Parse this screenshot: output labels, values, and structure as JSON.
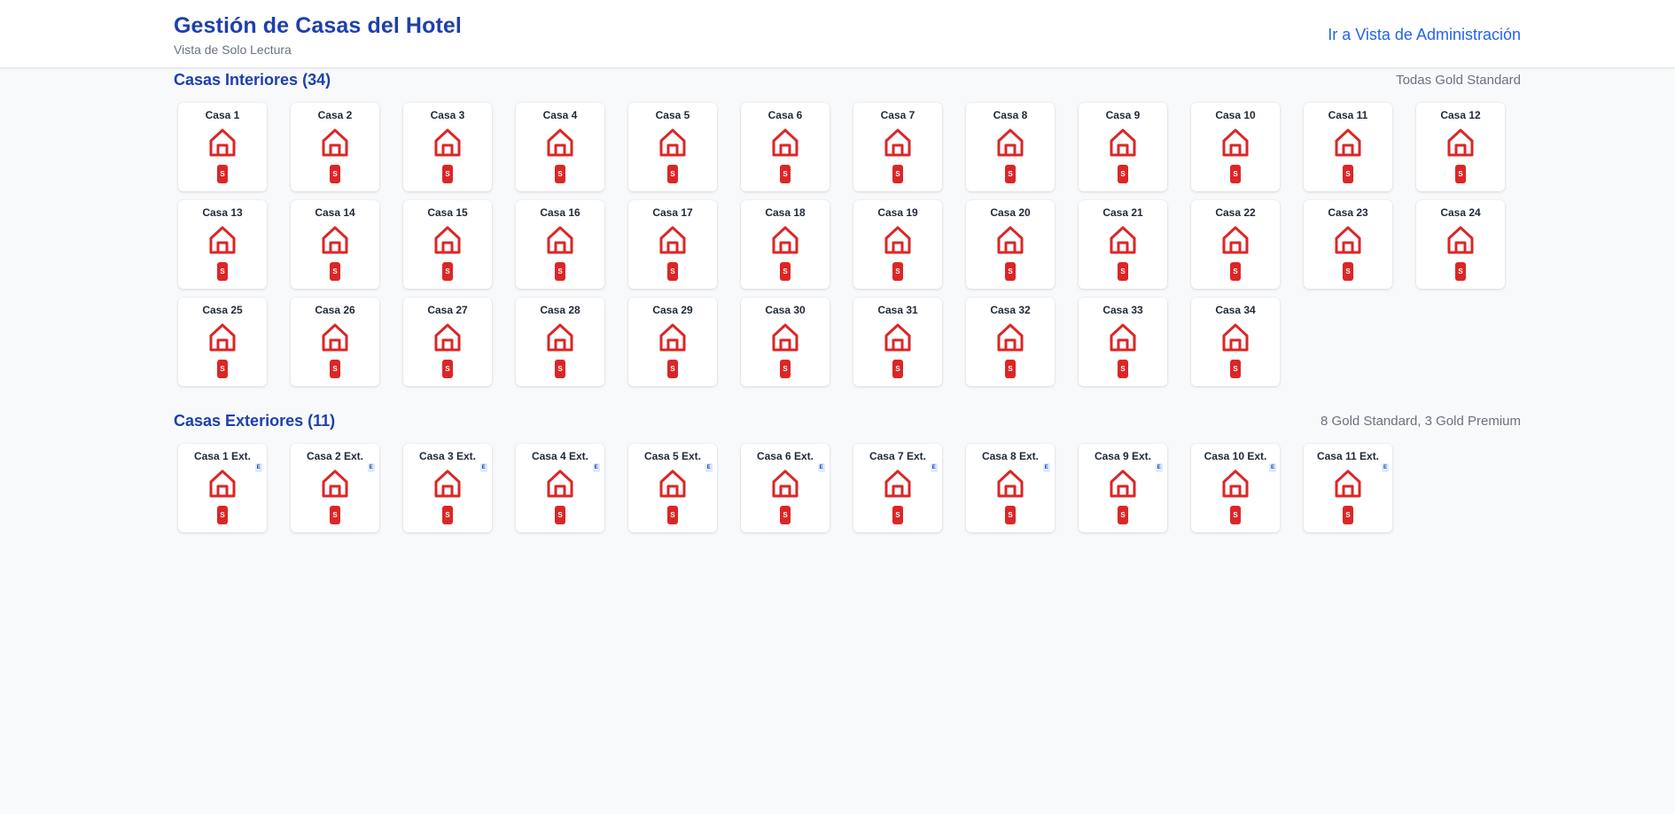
{
  "header": {
    "title": "Gestión de Casas del Hotel",
    "subtitle": "Vista de Solo Lectura",
    "admin_link": "Ir a Vista de Administración"
  },
  "interior": {
    "title": "Casas Interiores (34)",
    "summary": "Todas Gold Standard",
    "houses": [
      {
        "name": "Casa 1",
        "level": "S"
      },
      {
        "name": "Casa 2",
        "level": "S"
      },
      {
        "name": "Casa 3",
        "level": "S"
      },
      {
        "name": "Casa 4",
        "level": "S"
      },
      {
        "name": "Casa 5",
        "level": "S"
      },
      {
        "name": "Casa 6",
        "level": "S"
      },
      {
        "name": "Casa 7",
        "level": "S"
      },
      {
        "name": "Casa 8",
        "level": "S"
      },
      {
        "name": "Casa 9",
        "level": "S"
      },
      {
        "name": "Casa 10",
        "level": "S"
      },
      {
        "name": "Casa 11",
        "level": "S"
      },
      {
        "name": "Casa 12",
        "level": "S"
      },
      {
        "name": "Casa 13",
        "level": "S"
      },
      {
        "name": "Casa 14",
        "level": "S"
      },
      {
        "name": "Casa 15",
        "level": "S"
      },
      {
        "name": "Casa 16",
        "level": "S"
      },
      {
        "name": "Casa 17",
        "level": "S"
      },
      {
        "name": "Casa 18",
        "level": "S"
      },
      {
        "name": "Casa 19",
        "level": "S"
      },
      {
        "name": "Casa 20",
        "level": "S"
      },
      {
        "name": "Casa 21",
        "level": "S"
      },
      {
        "name": "Casa 22",
        "level": "S"
      },
      {
        "name": "Casa 23",
        "level": "S"
      },
      {
        "name": "Casa 24",
        "level": "S"
      },
      {
        "name": "Casa 25",
        "level": "S"
      },
      {
        "name": "Casa 26",
        "level": "S"
      },
      {
        "name": "Casa 27",
        "level": "S"
      },
      {
        "name": "Casa 28",
        "level": "S"
      },
      {
        "name": "Casa 29",
        "level": "S"
      },
      {
        "name": "Casa 30",
        "level": "S"
      },
      {
        "name": "Casa 31",
        "level": "S"
      },
      {
        "name": "Casa 32",
        "level": "S"
      },
      {
        "name": "Casa 33",
        "level": "S"
      },
      {
        "name": "Casa 34",
        "level": "S"
      }
    ]
  },
  "exterior": {
    "title": "Casas Exteriores (11)",
    "summary": "8 Gold Standard, 3 Gold Premium",
    "houses": [
      {
        "name": "Casa 1 Ext.",
        "level": "S",
        "tag": "E"
      },
      {
        "name": "Casa 2 Ext.",
        "level": "S",
        "tag": "E"
      },
      {
        "name": "Casa 3 Ext.",
        "level": "S",
        "tag": "E"
      },
      {
        "name": "Casa 4 Ext.",
        "level": "S",
        "tag": "E"
      },
      {
        "name": "Casa 5 Ext.",
        "level": "S",
        "tag": "E"
      },
      {
        "name": "Casa 6 Ext.",
        "level": "S",
        "tag": "E"
      },
      {
        "name": "Casa 7 Ext.",
        "level": "S",
        "tag": "E"
      },
      {
        "name": "Casa 8 Ext.",
        "level": "S",
        "tag": "E"
      },
      {
        "name": "Casa 9 Ext.",
        "level": "S",
        "tag": "E"
      },
      {
        "name": "Casa 10 Ext.",
        "level": "S",
        "tag": "E"
      },
      {
        "name": "Casa 11 Ext.",
        "level": "S",
        "tag": "E"
      }
    ]
  },
  "icons": {
    "house": "house-icon"
  },
  "colors": {
    "accent": "#1e3fae",
    "link": "#2563eb",
    "house": "#dc2626",
    "ext_badge_bg": "#dbeafe"
  }
}
